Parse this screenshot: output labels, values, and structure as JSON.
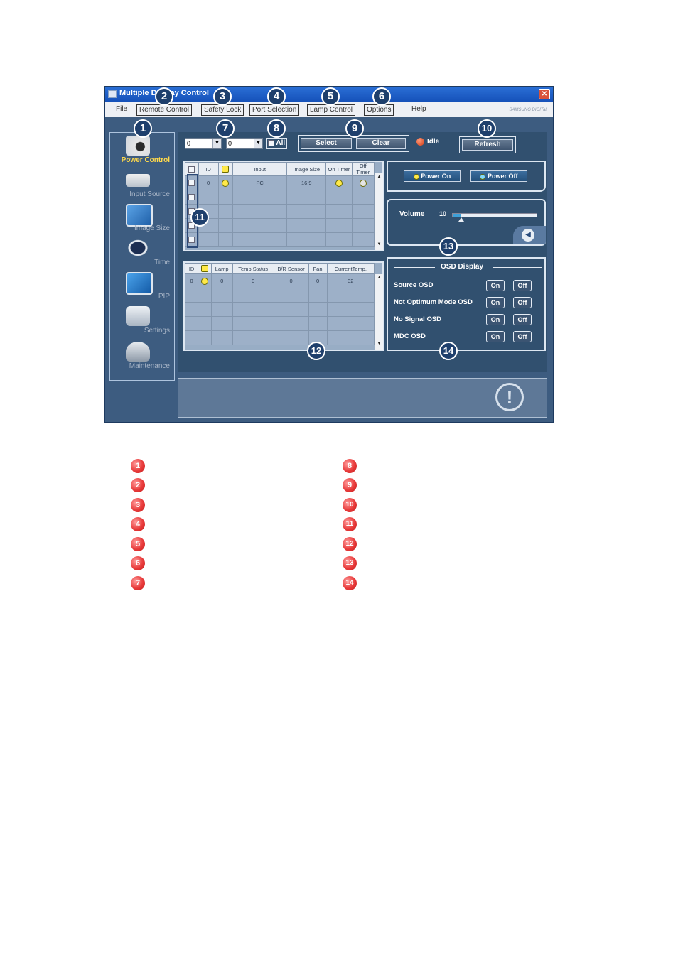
{
  "window": {
    "title": "Multiple Display Control",
    "close_label": "✕",
    "brand": "SAMSUNG DIGITall"
  },
  "menu": [
    "File",
    "Remote Control",
    "Safety Lock",
    "Port Selection",
    "Lamp Control",
    "Options",
    "Help"
  ],
  "sidebar": [
    {
      "label": "Power Control",
      "icon": "power-control-icon",
      "active": true
    },
    {
      "label": "Input Source",
      "icon": "input-source-icon"
    },
    {
      "label": "Image Size",
      "icon": "image-size-icon"
    },
    {
      "label": "Time",
      "icon": "clock-icon"
    },
    {
      "label": "PIP",
      "icon": "pip-icon"
    },
    {
      "label": "Settings",
      "icon": "settings-icon"
    },
    {
      "label": "Maintenance",
      "icon": "maintenance-icon"
    }
  ],
  "toolbar": {
    "combo1_value": "0",
    "combo2_value": "0",
    "all_label": "All",
    "select_label": "Select",
    "clear_label": "Clear",
    "status_label": "Idle",
    "refresh_label": "Refresh"
  },
  "grid1": {
    "headers": [
      "☑",
      "ID",
      "●",
      "Input",
      "Image Size",
      "On Timer",
      "Off Timer"
    ],
    "row": {
      "id": "0",
      "input": "PC",
      "image_size": "16:9"
    }
  },
  "grid2": {
    "headers": [
      "ID",
      "●",
      "Lamp",
      "Temp.Status",
      "B/R Sensor",
      "Fan",
      "CurrentTemp."
    ],
    "row": {
      "id": "0",
      "lamp": "0",
      "temp_status": "0",
      "br_sensor": "0",
      "fan": "0",
      "current_temp": "32"
    }
  },
  "power": {
    "on_label": "Power On",
    "off_label": "Power Off"
  },
  "volume": {
    "label": "Volume",
    "value": "10",
    "level": 0.1
  },
  "osd": {
    "title": "OSD Display",
    "rows": [
      "Source OSD",
      "Not Optimum Mode OSD",
      "No Signal OSD",
      "MDC OSD"
    ],
    "on_label": "On",
    "off_label": "Off"
  },
  "callouts": [
    "1",
    "2",
    "3",
    "4",
    "5",
    "6",
    "7",
    "8",
    "9",
    "10",
    "11",
    "12",
    "13",
    "14"
  ],
  "colors": {
    "legend_red": "#e83a3a",
    "window_blue": "#3d5c80",
    "led_yellow": "#ffe94a"
  }
}
